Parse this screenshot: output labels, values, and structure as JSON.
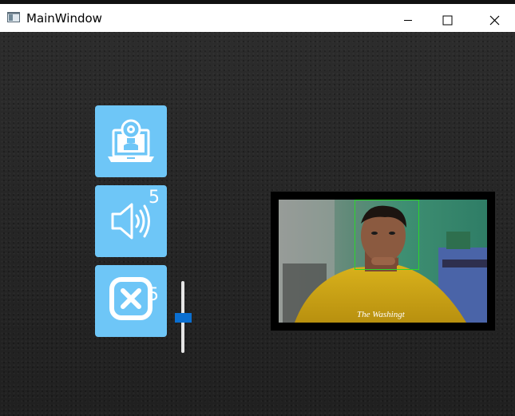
{
  "window": {
    "title": "MainWindow",
    "controls": {
      "minimize": "minimize-icon",
      "maximize": "maximize-icon",
      "close": "close-icon"
    }
  },
  "tiles": [
    {
      "name": "webcam-tile",
      "icon": "laptop-webcam-icon",
      "count": ""
    },
    {
      "name": "volume-tile",
      "icon": "speaker-icon",
      "count": "5"
    },
    {
      "name": "close-tile",
      "icon": "close-box-icon",
      "count": "5"
    }
  ],
  "slider": {
    "value_fraction": 0.5
  },
  "camera": {
    "overlay_text": "The Washingt",
    "face_detection_color": "#2bd52b"
  },
  "colors": {
    "tile": "#6ec6f7",
    "slider_handle": "#0a6fd1",
    "background": "#262626"
  }
}
